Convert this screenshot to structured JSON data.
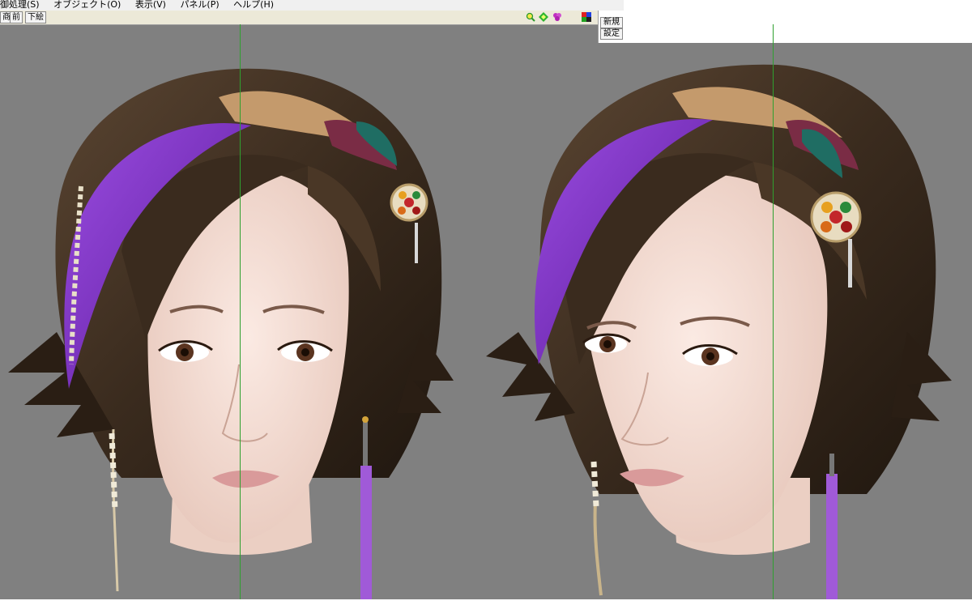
{
  "menu": {
    "items": [
      "御処理(S)",
      "オブジェクト(O)",
      "表示(V)",
      "パネル(P)",
      "ヘルプ(H)"
    ]
  },
  "toolbar": {
    "btn1": "商",
    "btn2": "前",
    "btn3": "下絵"
  },
  "sidepanel": {
    "new_label": "新規",
    "settings_label": "設定"
  },
  "icons": [
    "zoom-icon",
    "move-icon",
    "rotate-icon",
    "color-palette-icon"
  ],
  "colors": {
    "background": "#808080",
    "axis": "#2fa02f",
    "hair": "#3a2b1e",
    "hair_highlight": "#7b2cc0",
    "skin": "#f3ddd3"
  }
}
